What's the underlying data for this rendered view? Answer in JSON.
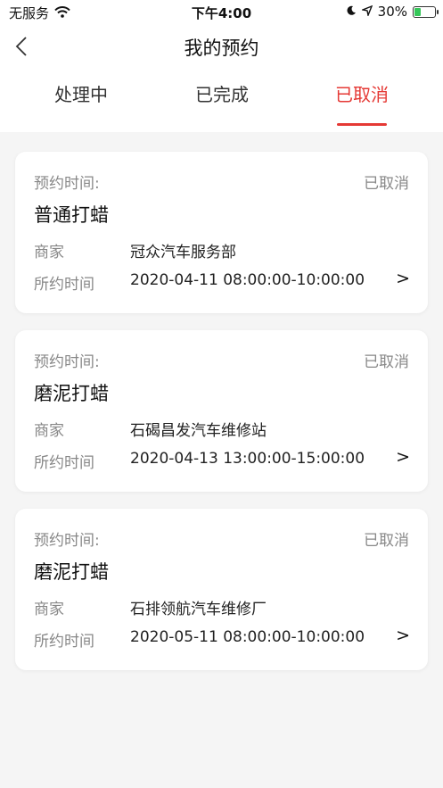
{
  "status_bar": {
    "carrier": "无服务",
    "time": "下午4:00",
    "battery": "30%"
  },
  "nav": {
    "title": "我的预约"
  },
  "tabs": [
    {
      "label": "处理中",
      "active": false
    },
    {
      "label": "已完成",
      "active": false
    },
    {
      "label": "已取消",
      "active": true
    }
  ],
  "colors": {
    "accent": "#e53935"
  },
  "cards": [
    {
      "time_label": "预约时间:",
      "status": "已取消",
      "service": "普通打蜡",
      "merchant_label": "商家",
      "merchant": "冠众汽车服务部",
      "appt_label": "所约时间",
      "appt_time": "2020-04-11 08:00:00-10:00:00",
      "arrow": ">"
    },
    {
      "time_label": "预约时间:",
      "status": "已取消",
      "service": "磨泥打蜡",
      "merchant_label": "商家",
      "merchant": "石碣昌发汽车维修站",
      "appt_label": "所约时间",
      "appt_time": "2020-04-13 13:00:00-15:00:00",
      "arrow": ">"
    },
    {
      "time_label": "预约时间:",
      "status": "已取消",
      "service": "磨泥打蜡",
      "merchant_label": "商家",
      "merchant": "石排领航汽车维修厂",
      "appt_label": "所约时间",
      "appt_time": "2020-05-11 08:00:00-10:00:00",
      "arrow": ">"
    }
  ]
}
